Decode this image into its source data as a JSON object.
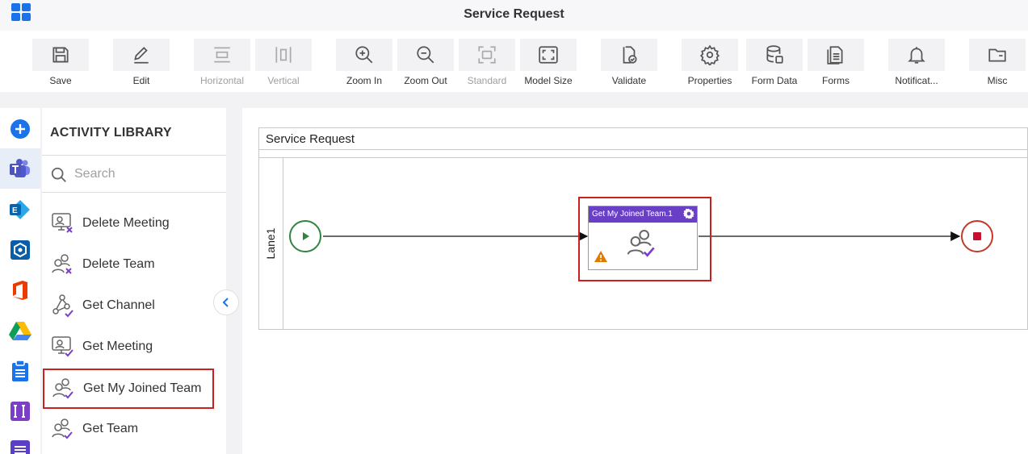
{
  "window": {
    "title": "Service Request"
  },
  "toolbar": {
    "items": [
      {
        "label": "Save",
        "icon": "save-icon",
        "enabled": true
      },
      {
        "label": "Edit",
        "icon": "edit-icon",
        "enabled": true
      },
      {
        "label": "Horizontal",
        "icon": "horizontal-icon",
        "enabled": false
      },
      {
        "label": "Vertical",
        "icon": "vertical-icon",
        "enabled": false
      },
      {
        "label": "Zoom In",
        "icon": "zoom-in-icon",
        "enabled": true
      },
      {
        "label": "Zoom Out",
        "icon": "zoom-out-icon",
        "enabled": true
      },
      {
        "label": "Standard",
        "icon": "standard-icon",
        "enabled": false
      },
      {
        "label": "Model Size",
        "icon": "model-size-icon",
        "enabled": true
      },
      {
        "label": "Validate",
        "icon": "validate-icon",
        "enabled": true
      },
      {
        "label": "Properties",
        "icon": "gear-icon",
        "enabled": true
      },
      {
        "label": "Form Data",
        "icon": "database-icon",
        "enabled": true
      },
      {
        "label": "Forms",
        "icon": "forms-icon",
        "enabled": true
      },
      {
        "label": "Notificat...",
        "icon": "bell-icon",
        "enabled": true
      },
      {
        "label": "Misc",
        "icon": "folder-icon",
        "enabled": true
      }
    ]
  },
  "rail": {
    "icons": [
      "add-icon",
      "teams-icon",
      "exchange-icon",
      "azure-icon",
      "office-icon",
      "google-drive-icon",
      "clipboard-icon",
      "text-field-icon",
      "list-icon"
    ]
  },
  "library": {
    "title": "ACTIVITY LIBRARY",
    "search_placeholder": "Search",
    "items": [
      {
        "label": "Delete Meeting",
        "icon": "delete-meeting-icon",
        "selected": false
      },
      {
        "label": "Delete Team",
        "icon": "delete-team-icon",
        "selected": false
      },
      {
        "label": "Get Channel",
        "icon": "get-channel-icon",
        "selected": false
      },
      {
        "label": "Get Meeting",
        "icon": "get-meeting-icon",
        "selected": false
      },
      {
        "label": "Get My Joined Team",
        "icon": "get-my-joined-team-icon",
        "selected": true
      },
      {
        "label": "Get Team",
        "icon": "get-team-icon",
        "selected": false
      }
    ]
  },
  "canvas": {
    "pool_title": "Service Request",
    "lane_label": "Lane1",
    "task": {
      "title": "Get My Joined Team.1",
      "warning": true
    },
    "colors": {
      "task_header": "#6a3fc7",
      "start": "#2e8540",
      "end": "#c0392b",
      "highlight": "#cc1f1f"
    }
  }
}
